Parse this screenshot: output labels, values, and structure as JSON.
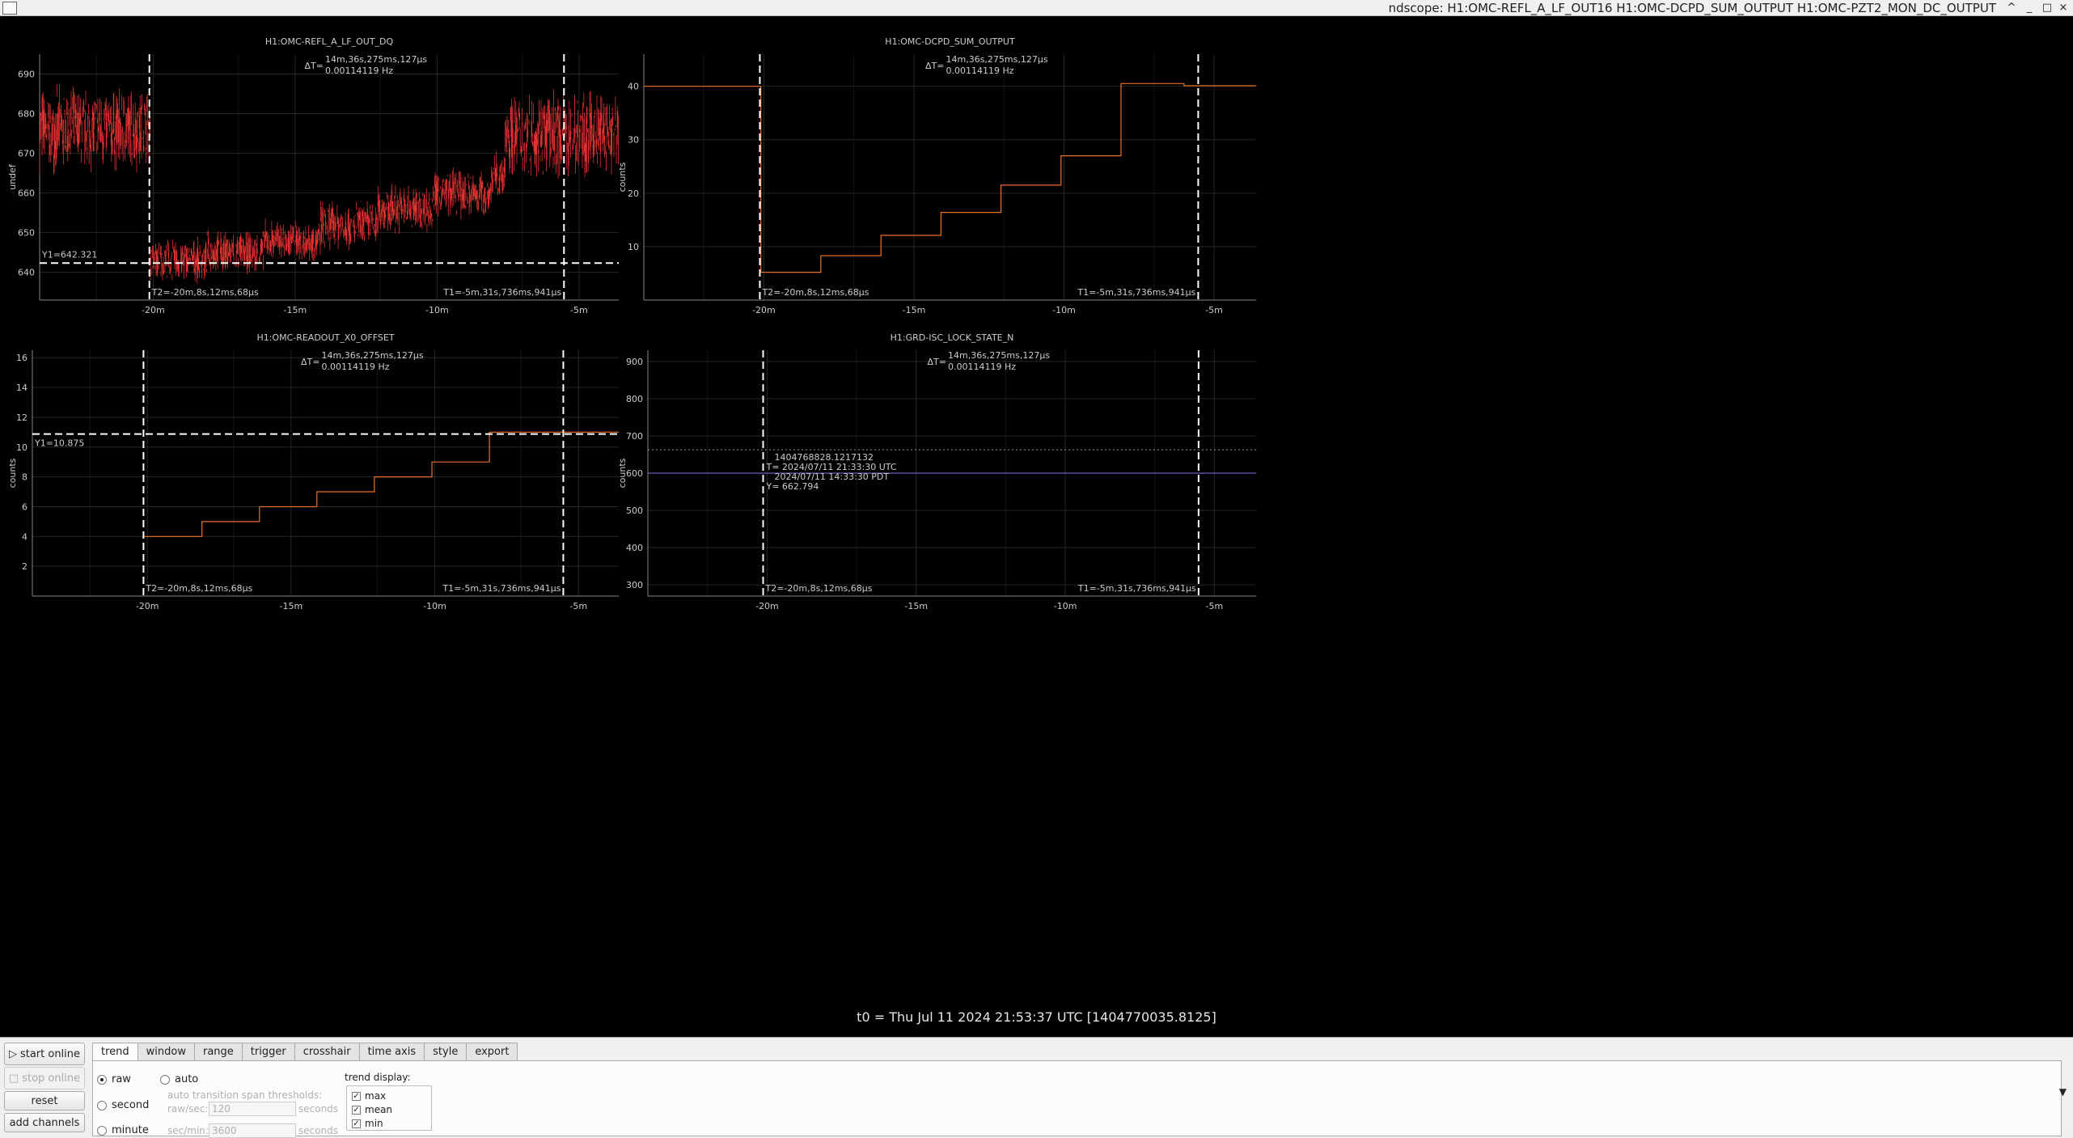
{
  "window": {
    "title": "ndscope: H1:OMC-REFL_A_LF_OUT16 H1:OMC-DCPD_SUM_OUTPUT H1:OMC-PZT2_MON_DC_OUTPUT",
    "buttons": [
      "^",
      "_",
      "□",
      "×"
    ]
  },
  "common": {
    "x_ticks": [
      "-20m",
      "-15m",
      "-10m",
      "-5m"
    ],
    "x_range_min": [
      -24,
      -3.6
    ],
    "dt_label": "ΔT=",
    "dt_line1": "14m,36s,275ms,127µs",
    "dt_line2": "0.00114119 Hz",
    "t2_label": "T2=-20m,8s,12ms,68µs",
    "t1_label": "T1=-5m,31s,736ms,941µs",
    "t2_min": -20.134,
    "t1_min": -5.529
  },
  "t0_label": "t0 = Thu Jul 11 2024 21:53:37 UTC [1404770035.8125]",
  "colors": {
    "background": "#000000",
    "trace_red": "#e03030",
    "trace_orange": "#e8712a",
    "trace_purple": "#6a5fb8",
    "cursor": "#ffffff",
    "grid": "#262626",
    "axis_text": "#cccccc"
  },
  "chart_data": [
    {
      "type": "line",
      "title": "H1:OMC-REFL_A_LF_OUT_DQ",
      "ylabel": "undef",
      "ylim": [
        633,
        695
      ],
      "yticks": [
        640,
        650,
        660,
        670,
        680,
        690
      ],
      "y_cursor_label": "Y1=642.321",
      "y_cursor": 642.321,
      "series": [
        {
          "segments": [
            {
              "x": [
                -24,
                -20.1
              ],
              "mean": 676,
              "amp": 12
            },
            {
              "x": [
                -20.1,
                -18.1
              ],
              "mean": 643,
              "amp": 6
            },
            {
              "x": [
                -18.1,
                -16.1
              ],
              "mean": 645,
              "amp": 6
            },
            {
              "x": [
                -16.1,
                -14.1
              ],
              "mean": 648,
              "amp": 6
            },
            {
              "x": [
                -14.1,
                -12.1
              ],
              "mean": 652,
              "amp": 7
            },
            {
              "x": [
                -12.1,
                -10.1
              ],
              "mean": 656,
              "amp": 7
            },
            {
              "x": [
                -10.1,
                -8.1
              ],
              "mean": 660,
              "amp": 7
            },
            {
              "x": [
                -8.1,
                -7.6
              ],
              "mean": 664,
              "amp": 7
            },
            {
              "x": [
                -7.6,
                -3.6
              ],
              "mean": 675,
              "amp": 12
            }
          ]
        }
      ]
    },
    {
      "type": "line",
      "title": "H1:OMC-DCPD_SUM_OUTPUT",
      "ylabel": "counts",
      "ylim": [
        0,
        46
      ],
      "yticks": [
        10,
        20,
        30,
        40
      ],
      "series": [
        {
          "steps": [
            [
              -24,
              40
            ],
            [
              -20.1,
              5.2
            ],
            [
              -18.1,
              8.3
            ],
            [
              -16.1,
              12.1
            ],
            [
              -14.1,
              16.4
            ],
            [
              -12.1,
              21.5
            ],
            [
              -10.1,
              27.0
            ],
            [
              -8.1,
              40.5
            ],
            [
              -6.0,
              40.1
            ]
          ]
        }
      ]
    },
    {
      "type": "line",
      "title": "H1:OMC-READOUT_X0_OFFSET",
      "ylabel": "counts",
      "ylim": [
        0,
        16.5
      ],
      "yticks": [
        2,
        4,
        6,
        8,
        10,
        12,
        14,
        16
      ],
      "y_cursor_label": "Y1=10.875",
      "y_cursor": 10.875,
      "series": [
        {
          "steps": [
            [
              -20.1,
              4
            ],
            [
              -18.1,
              5
            ],
            [
              -16.1,
              6
            ],
            [
              -14.1,
              7
            ],
            [
              -12.1,
              8
            ],
            [
              -10.1,
              9
            ],
            [
              -8.1,
              11
            ],
            [
              -3.6,
              11
            ]
          ]
        }
      ]
    },
    {
      "type": "line",
      "title": "H1:GRD-ISC_LOCK_STATE_N",
      "ylabel": "counts",
      "ylim": [
        270,
        930
      ],
      "yticks": [
        300,
        400,
        500,
        600,
        700,
        800,
        900
      ],
      "series": [
        {
          "steps": [
            [
              -24,
              600
            ],
            [
              -3.6,
              600
            ]
          ]
        }
      ],
      "hover_y": 662.794,
      "hover_lines": [
        "1404768828.1217132",
        "T= 2024/07/11 21:33:30 UTC",
        "2024/07/11 14:33:30 PDT",
        "Y= 662.794"
      ]
    }
  ],
  "controls": {
    "left_buttons": [
      "start online",
      "stop online",
      "reset",
      "add channels"
    ],
    "tabs": [
      "trend",
      "window",
      "range",
      "trigger",
      "crosshair",
      "time axis",
      "style",
      "export"
    ],
    "active_tab": "trend",
    "radio_raw": "raw",
    "radio_second": "second",
    "radio_minute": "minute",
    "radio_auto": "auto",
    "auto_label": "auto transition span thresholds:",
    "raw_sec_label": "raw/sec:",
    "raw_sec_value": "120",
    "sec_min_label": "sec/min:",
    "sec_min_value": "3600",
    "seconds_label": "seconds",
    "trend_display_label": "trend display:",
    "checks": [
      "max",
      "mean",
      "min"
    ]
  }
}
